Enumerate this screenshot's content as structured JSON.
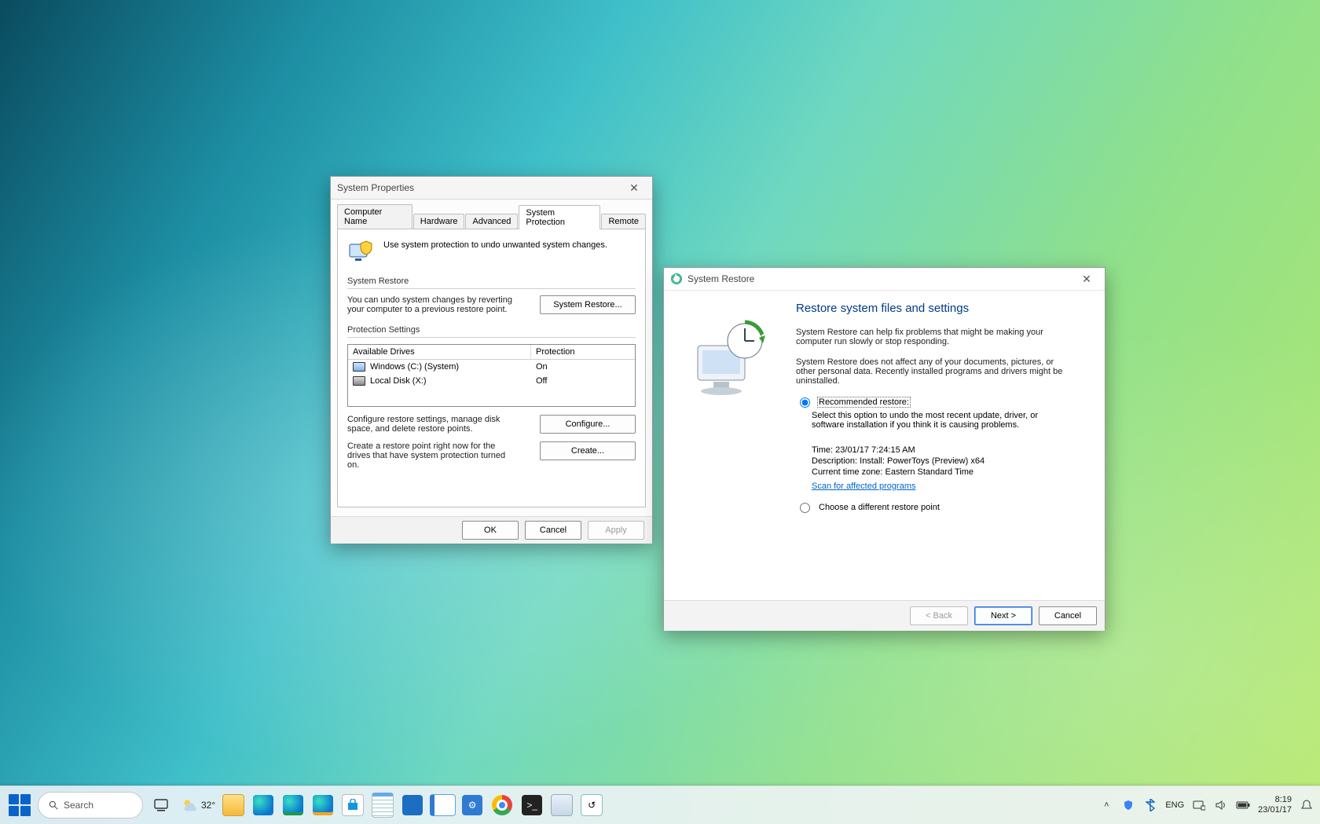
{
  "system_properties": {
    "title": "System Properties",
    "tabs": {
      "computer_name": "Computer Name",
      "hardware": "Hardware",
      "advanced": "Advanced",
      "system_protection": "System Protection",
      "remote": "Remote"
    },
    "intro": "Use system protection to undo unwanted system changes.",
    "section_restore_title": "System Restore",
    "restore_desc": "You can undo system changes by reverting your computer to a previous restore point.",
    "btn_system_restore": "System Restore...",
    "section_settings_title": "Protection Settings",
    "col_drives": "Available Drives",
    "col_protection": "Protection",
    "drives": [
      {
        "name": "Windows (C:) (System)",
        "status": "On",
        "type": "sys"
      },
      {
        "name": "Local Disk (X:)",
        "status": "Off",
        "type": "ext"
      }
    ],
    "configure_desc": "Configure restore settings, manage disk space, and delete restore points.",
    "btn_configure": "Configure...",
    "create_desc": "Create a restore point right now for the drives that have system protection turned on.",
    "btn_create": "Create...",
    "btn_ok": "OK",
    "btn_cancel": "Cancel",
    "btn_apply": "Apply"
  },
  "system_restore": {
    "title": "System Restore",
    "heading": "Restore system files and settings",
    "p1": "System Restore can help fix problems that might be making your computer run slowly or stop responding.",
    "p2": "System Restore does not affect any of your documents, pictures, or other personal data. Recently installed programs and drivers might be uninstalled.",
    "opt_recommended": "Recommended restore:",
    "opt_recommended_desc": "Select this option to undo the most recent update, driver, or software installation if you think it is causing problems.",
    "kv_time": "Time: 23/01/17 7:24:15 AM",
    "kv_desc": "Description: Install: PowerToys (Preview) x64",
    "kv_tz": "Current time zone: Eastern Standard Time",
    "link_scan": "Scan for affected programs",
    "opt_different": "Choose a different restore point",
    "btn_back": "< Back",
    "btn_next": "Next >",
    "btn_cancel": "Cancel"
  },
  "taskbar": {
    "search_label": "Search",
    "weather_temp": "32°",
    "lang": "ENG",
    "time": "8:19",
    "date": "23/01/17"
  }
}
